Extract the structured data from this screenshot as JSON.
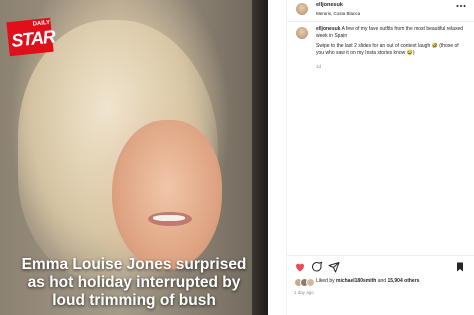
{
  "article_image": {
    "logo": {
      "top": "DAILY",
      "main": "STAR"
    },
    "headline_lines": [
      "Emma Louise Jones surprised",
      "as hot holiday interrupted by",
      "loud trimming of bush"
    ]
  },
  "post": {
    "username": "elljonesuk",
    "location": "Meraris, Costa Blanca",
    "caption_username": "elljonesuk",
    "caption_text": "A few of my fave outfits from the most beautiful relaxed week in Spain",
    "caption_text2": "Swipe to the last 2 slides for an out of context laugh 🤣 (those of you who saw it on my Insta stories know 😂)",
    "caption_time": "1d",
    "liked_by_prefix": "Liked by",
    "liked_by_user": "michael180smith",
    "liked_by_and": "and",
    "liked_by_count": "15,904 others",
    "time_ago": "1 day ago"
  },
  "colors": {
    "logo_red": "#e10f1a",
    "like_red": "#ed4956",
    "text": "#262626",
    "muted": "#8e8e8e"
  },
  "icons": [
    "more-options-icon",
    "heart-icon",
    "comment-icon",
    "share-icon",
    "bookmark-icon"
  ]
}
